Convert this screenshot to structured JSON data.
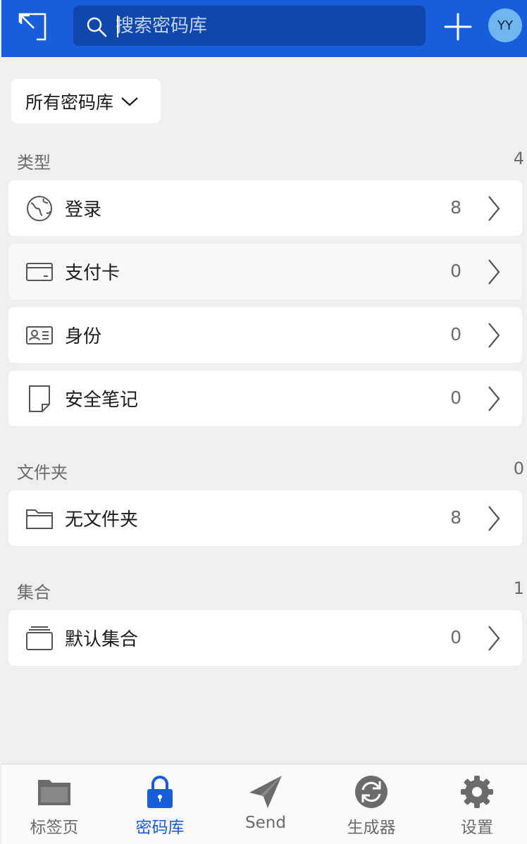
{
  "header": {
    "search_placeholder": "搜索密码库",
    "avatar_initials": "YY",
    "accent_color": "#175ddc"
  },
  "vault_selector": {
    "label": "所有密码库"
  },
  "sections": {
    "types": {
      "title": "类型",
      "count": "4",
      "items": [
        {
          "icon": "globe-icon",
          "label": "登录",
          "count": "8"
        },
        {
          "icon": "credit-card-icon",
          "label": "支付卡",
          "count": "0"
        },
        {
          "icon": "id-card-icon",
          "label": "身份",
          "count": "0"
        },
        {
          "icon": "note-icon",
          "label": "安全笔记",
          "count": "0"
        }
      ]
    },
    "folders": {
      "title": "文件夹",
      "count": "0",
      "items": [
        {
          "icon": "folder-icon",
          "label": "无文件夹",
          "count": "8"
        }
      ]
    },
    "collections": {
      "title": "集合",
      "count": "1",
      "items": [
        {
          "icon": "collection-icon",
          "label": "默认集合",
          "count": "0"
        }
      ]
    }
  },
  "bottom_nav": {
    "tabs": [
      {
        "icon": "folder-tab-icon",
        "label": "标签页",
        "active": false
      },
      {
        "icon": "lock-icon",
        "label": "密码库",
        "active": true
      },
      {
        "icon": "paper-plane-icon",
        "label": "Send",
        "active": false
      },
      {
        "icon": "refresh-icon",
        "label": "生成器",
        "active": false
      },
      {
        "icon": "gear-icon",
        "label": "设置",
        "active": false
      }
    ]
  }
}
